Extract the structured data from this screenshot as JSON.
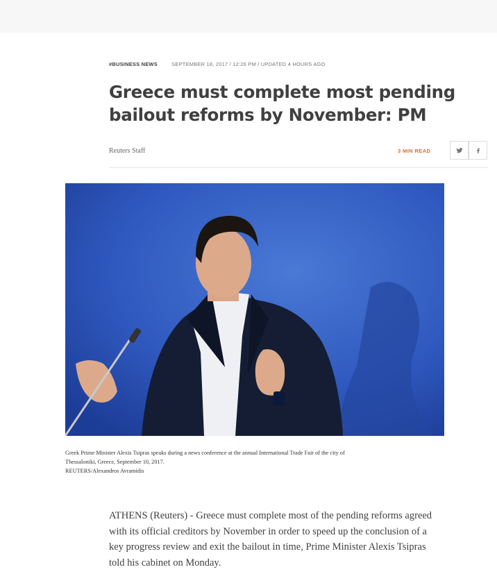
{
  "article": {
    "section": "#BUSINESS NEWS",
    "date": "SEPTEMBER 18, 2017 / 12:26 PM / UPDATED 4 HOURS AGO",
    "headline": "Greece must complete most pending bailout reforms by November: PM",
    "author": "Reuters Staff",
    "read_time": "3 MIN READ",
    "share": {
      "twitter_icon": "twitter-icon",
      "facebook_icon": "facebook-icon"
    },
    "photo": {
      "description_icon": "news-photo",
      "caption": "Greek Prime Minister Alexis Tsipras speaks during a news conference at the annual International Trade Fair of the city of Thessaloniki, Greece, September 10, 2017.",
      "credit": "REUTERS/Alexandros Avramidis"
    },
    "body": "ATHENS (Reuters) - Greece must complete most of the pending reforms agreed with its official creditors by November in order to speed up the conclusion of a key progress review and exit the bailout in time, Prime Minister Alexis Tsipras told his cabinet on Monday."
  },
  "colors": {
    "accent": "#dc6c2c",
    "text": "#404040",
    "photo_background": "#2e55b8"
  }
}
